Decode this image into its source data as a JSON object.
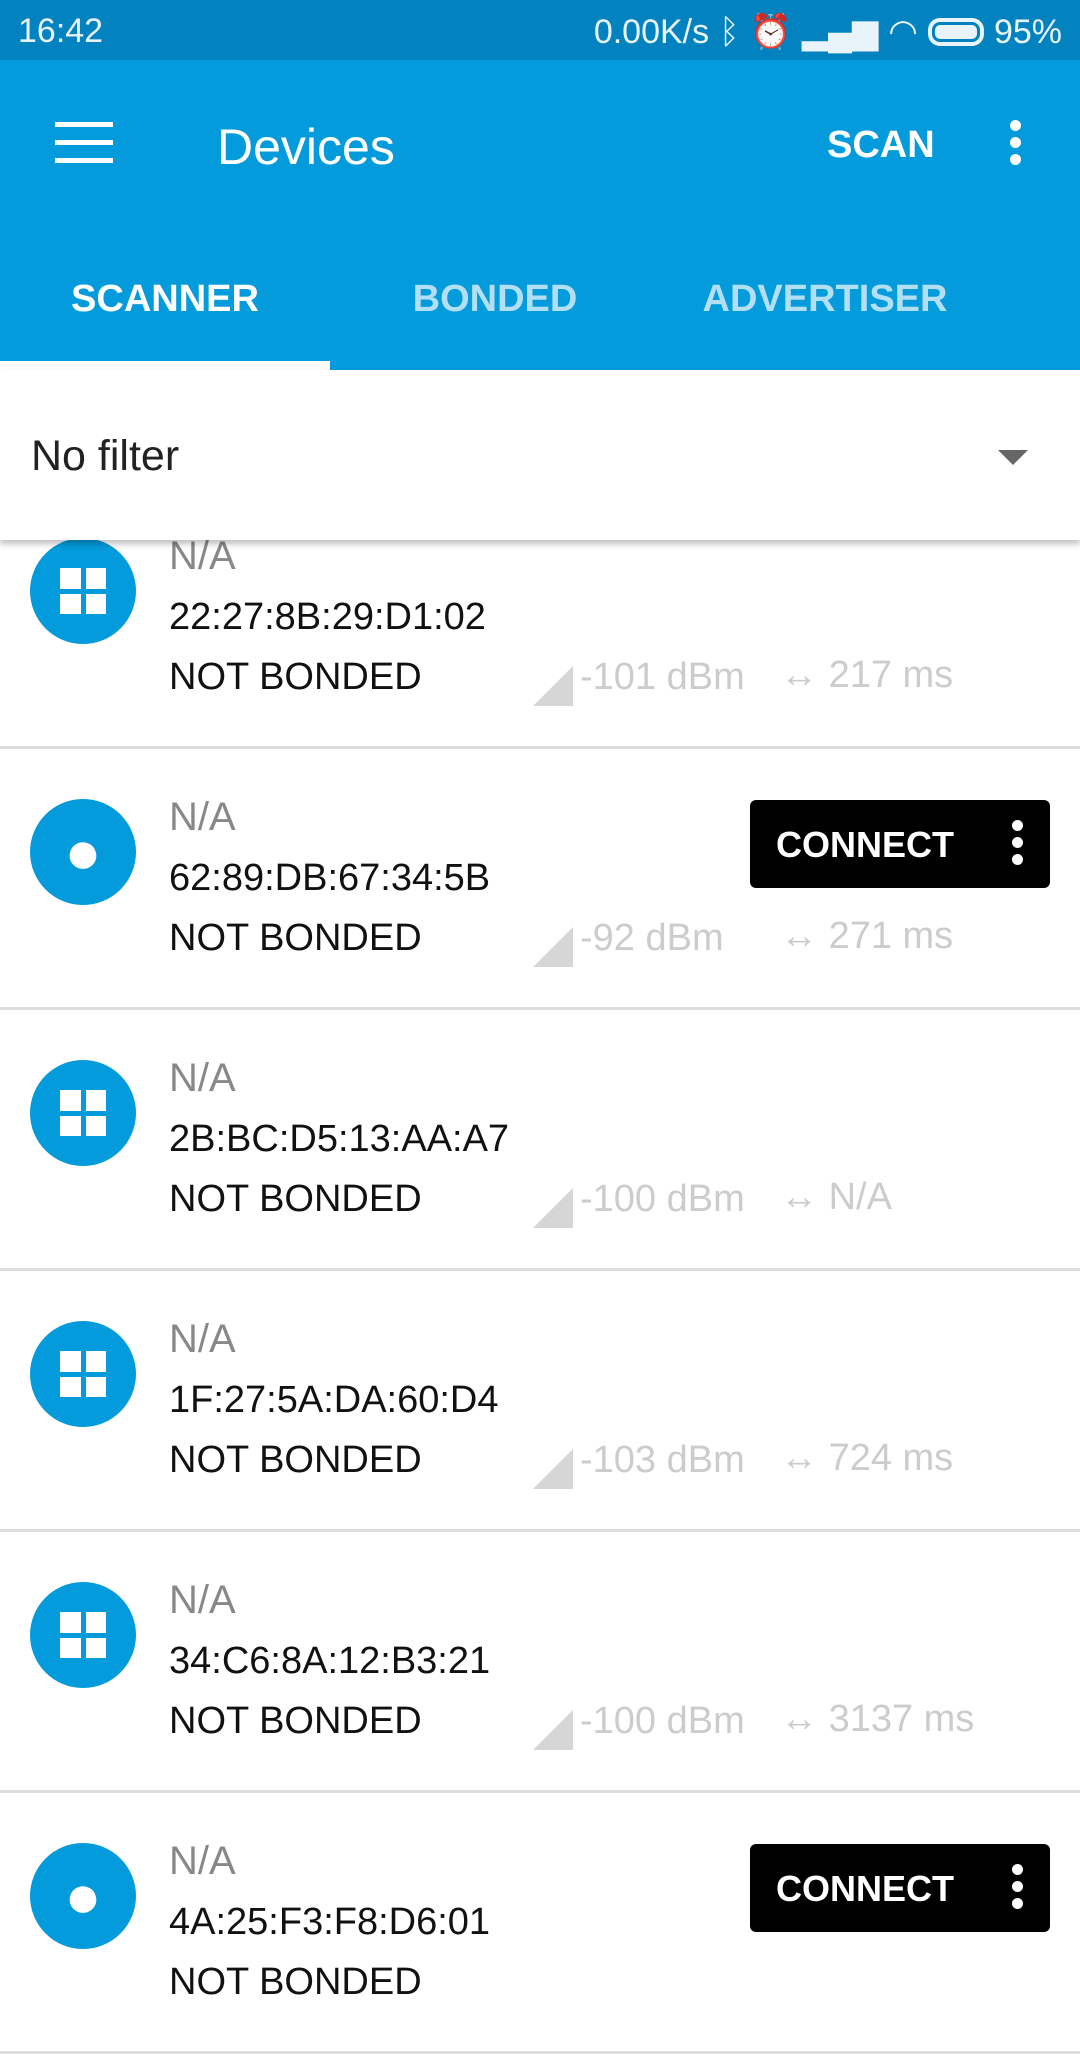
{
  "status_bar": {
    "time": "16:42",
    "net_speed": "0.00K/s",
    "icons": [
      "bluetooth-icon",
      "alarm-icon",
      "hd-signal-icon",
      "signal-icon",
      "wifi-icon",
      "battery-icon"
    ],
    "battery": "95%"
  },
  "toolbar": {
    "title": "Devices",
    "scan_label": "SCAN"
  },
  "tabs": [
    {
      "label": "SCANNER",
      "active": true
    },
    {
      "label": "BONDED",
      "active": false
    },
    {
      "label": "ADVERTISER",
      "active": false
    }
  ],
  "filter": {
    "value": "No filter"
  },
  "colors": {
    "primary": "#039BDB",
    "status_bar": "#0282BE"
  },
  "devices": [
    {
      "name": "N/A",
      "mac": "22:27:8B:29:D1:02",
      "bond": "NOT BONDED",
      "rssi": "-101 dBm",
      "interval": "217 ms",
      "type": "windows",
      "connect": ""
    },
    {
      "name": "N/A",
      "mac": "62:89:DB:67:34:5B",
      "bond": "NOT BONDED",
      "rssi": "-92 dBm",
      "interval": "271 ms",
      "type": "apple",
      "connect": "CONNECT"
    },
    {
      "name": "N/A",
      "mac": "2B:BC:D5:13:AA:A7",
      "bond": "NOT BONDED",
      "rssi": "-100 dBm",
      "interval": "N/A",
      "type": "windows",
      "connect": ""
    },
    {
      "name": "N/A",
      "mac": "1F:27:5A:DA:60:D4",
      "bond": "NOT BONDED",
      "rssi": "-103 dBm",
      "interval": "724 ms",
      "type": "windows",
      "connect": ""
    },
    {
      "name": "N/A",
      "mac": "34:C6:8A:12:B3:21",
      "bond": "NOT BONDED",
      "rssi": "-100 dBm",
      "interval": "3137 ms",
      "type": "windows",
      "connect": ""
    },
    {
      "name": "N/A",
      "mac": "4A:25:F3:F8:D6:01",
      "bond": "NOT BONDED",
      "rssi": "",
      "interval": "",
      "type": "apple",
      "connect": "CONNECT"
    }
  ]
}
